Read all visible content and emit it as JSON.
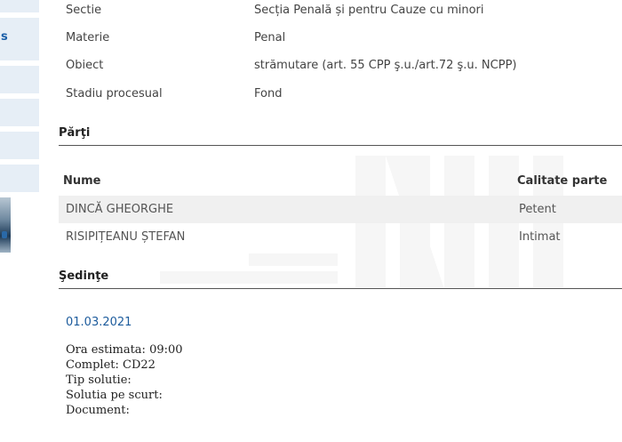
{
  "sidebar": {
    "visible_letter": "s"
  },
  "case_info": [
    {
      "label": "Sectie",
      "value": "Secția Penală și pentru Cauze cu minori"
    },
    {
      "label": "Materie",
      "value": "Penal"
    },
    {
      "label": "Obiect",
      "value": "strămutare (art. 55 CPP ş.u./art.72 ş.u. NCPP)"
    },
    {
      "label": "Stadiu procesual",
      "value": "Fond"
    }
  ],
  "parties": {
    "title": "Părţi",
    "columns": {
      "name": "Nume",
      "role": "Calitate parte"
    },
    "rows": [
      {
        "name": "DINCĂ GHEORGHE",
        "role": "Petent"
      },
      {
        "name": "RISIPIȚEANU ȘTEFAN",
        "role": "Intimat"
      }
    ]
  },
  "sessions": {
    "title": "Şedinţe",
    "date": "01.03.2021",
    "details": [
      "Ora estimata: 09:00",
      "Complet: CD22",
      "Tip solutie:",
      "Solutia pe scurt:",
      "Document:"
    ]
  },
  "colors": {
    "link_blue": "#1c5b9c",
    "sidebar_bg": "#e6eef6",
    "row_shade": "#f0f0f0"
  }
}
